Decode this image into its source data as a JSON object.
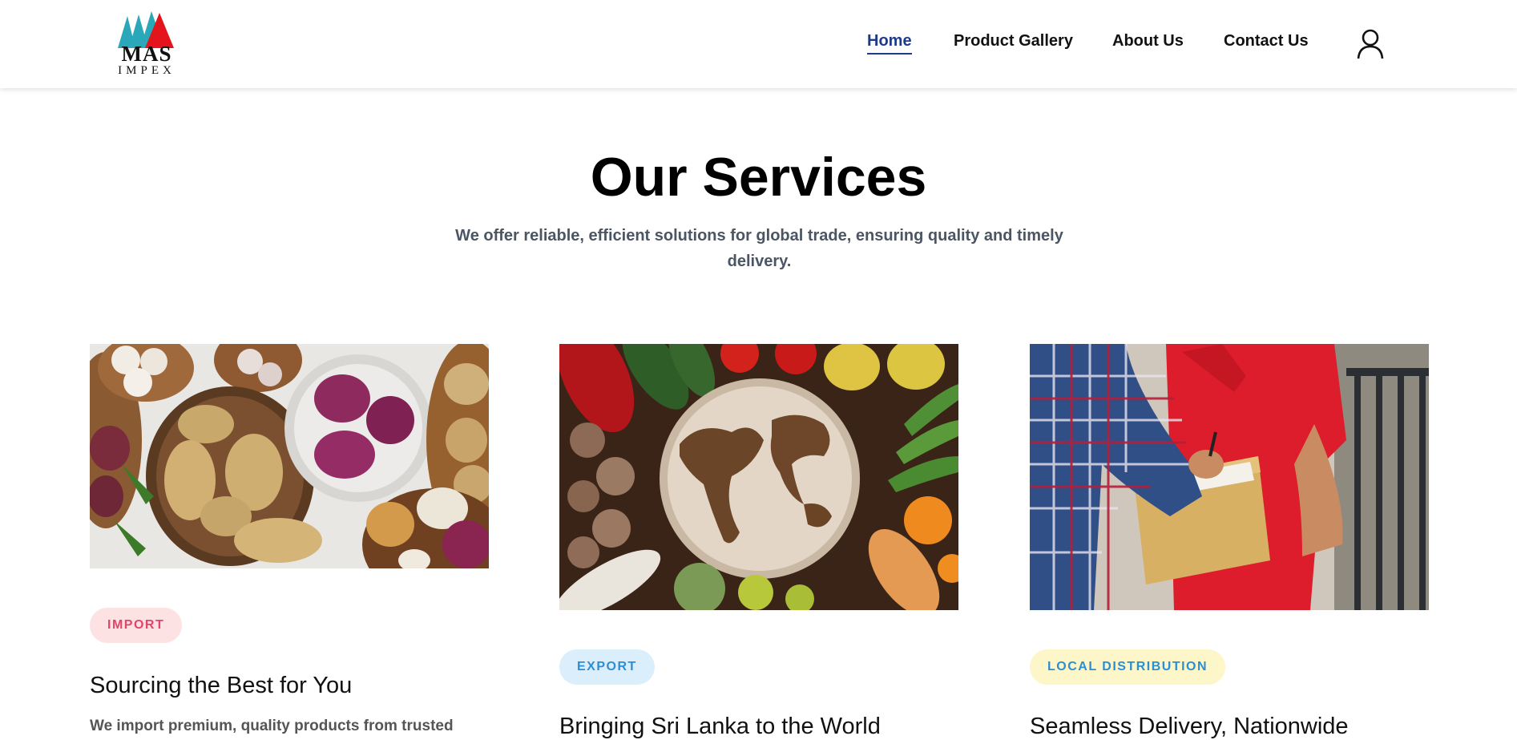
{
  "brand": {
    "name": "MAS",
    "sub": "IMPEX"
  },
  "nav": {
    "items": [
      {
        "label": "Home",
        "active": true
      },
      {
        "label": "Product Gallery",
        "active": false
      },
      {
        "label": "About Us",
        "active": false
      },
      {
        "label": "Contact Us",
        "active": false
      }
    ],
    "user_icon": "user-icon"
  },
  "hero": {
    "title": "Our Services",
    "subtitle": "We offer reliable, efficient solutions for global trade, ensuring quality and timely delivery."
  },
  "services": [
    {
      "badge": "IMPORT",
      "badge_bg": "#fde2e4",
      "badge_color": "#e0456a",
      "title": "Sourcing the Best for You",
      "desc": "We import premium, quality products from trusted",
      "image_alt": "vegetables-in-baskets-image"
    },
    {
      "badge": "EXPORT",
      "badge_bg": "#dbeefc",
      "badge_color": "#2b8fd6",
      "title": "Bringing Sri Lanka to the World",
      "desc": "",
      "image_alt": "world-map-plate-with-vegetables-image"
    },
    {
      "badge": "LOCAL DISTRIBUTION",
      "badge_bg": "#fdf6c9",
      "badge_color": "#2b8fd6",
      "title": "Seamless Delivery, Nationwide",
      "desc": "",
      "image_alt": "delivery-person-with-package-image"
    }
  ],
  "colors": {
    "accent": "#1e3a8a",
    "subtitle_text": "#4b5563"
  }
}
